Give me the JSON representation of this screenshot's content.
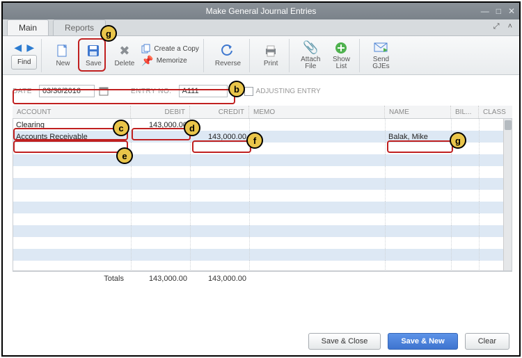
{
  "window": {
    "title": "Make General Journal Entries"
  },
  "tabs": {
    "main": "Main",
    "reports": "Reports"
  },
  "toolbar": {
    "find": "Find",
    "new": "New",
    "save": "Save",
    "delete": "Delete",
    "create_copy": "Create a Copy",
    "memorize": "Memorize",
    "reverse": "Reverse",
    "print": "Print",
    "attach_file": "Attach\nFile",
    "show_list": "Show\nList",
    "send_gjes": "Send\nGJEs"
  },
  "header": {
    "date_label": "DATE",
    "date_value": "03/30/2016",
    "entry_no_label": "ENTRY NO.",
    "entry_no_value": "A111",
    "adjusting_label": "ADJUSTING ENTRY"
  },
  "grid": {
    "columns": {
      "account": "ACCOUNT",
      "debit": "DEBIT",
      "credit": "CREDIT",
      "memo": "MEMO",
      "name": "NAME",
      "bill": "BIL...",
      "class": "CLASS"
    },
    "rows": [
      {
        "account": "Clearing",
        "debit": "143,000.00",
        "credit": "",
        "memo": "",
        "name": "",
        "bill": "",
        "class": ""
      },
      {
        "account": "Accounts Receivable",
        "debit": "",
        "credit": "143,000.00",
        "memo": "",
        "name": "Balak, Mike",
        "bill": "",
        "class": ""
      }
    ],
    "totals_label": "Totals",
    "totals_debit": "143,000.00",
    "totals_credit": "143,000.00"
  },
  "footer": {
    "save_close": "Save & Close",
    "save_new": "Save & New",
    "clear": "Clear"
  },
  "callouts": {
    "b": "b",
    "c": "c",
    "d": "d",
    "e": "e",
    "f": "f",
    "g": "g",
    "g2": "g"
  }
}
